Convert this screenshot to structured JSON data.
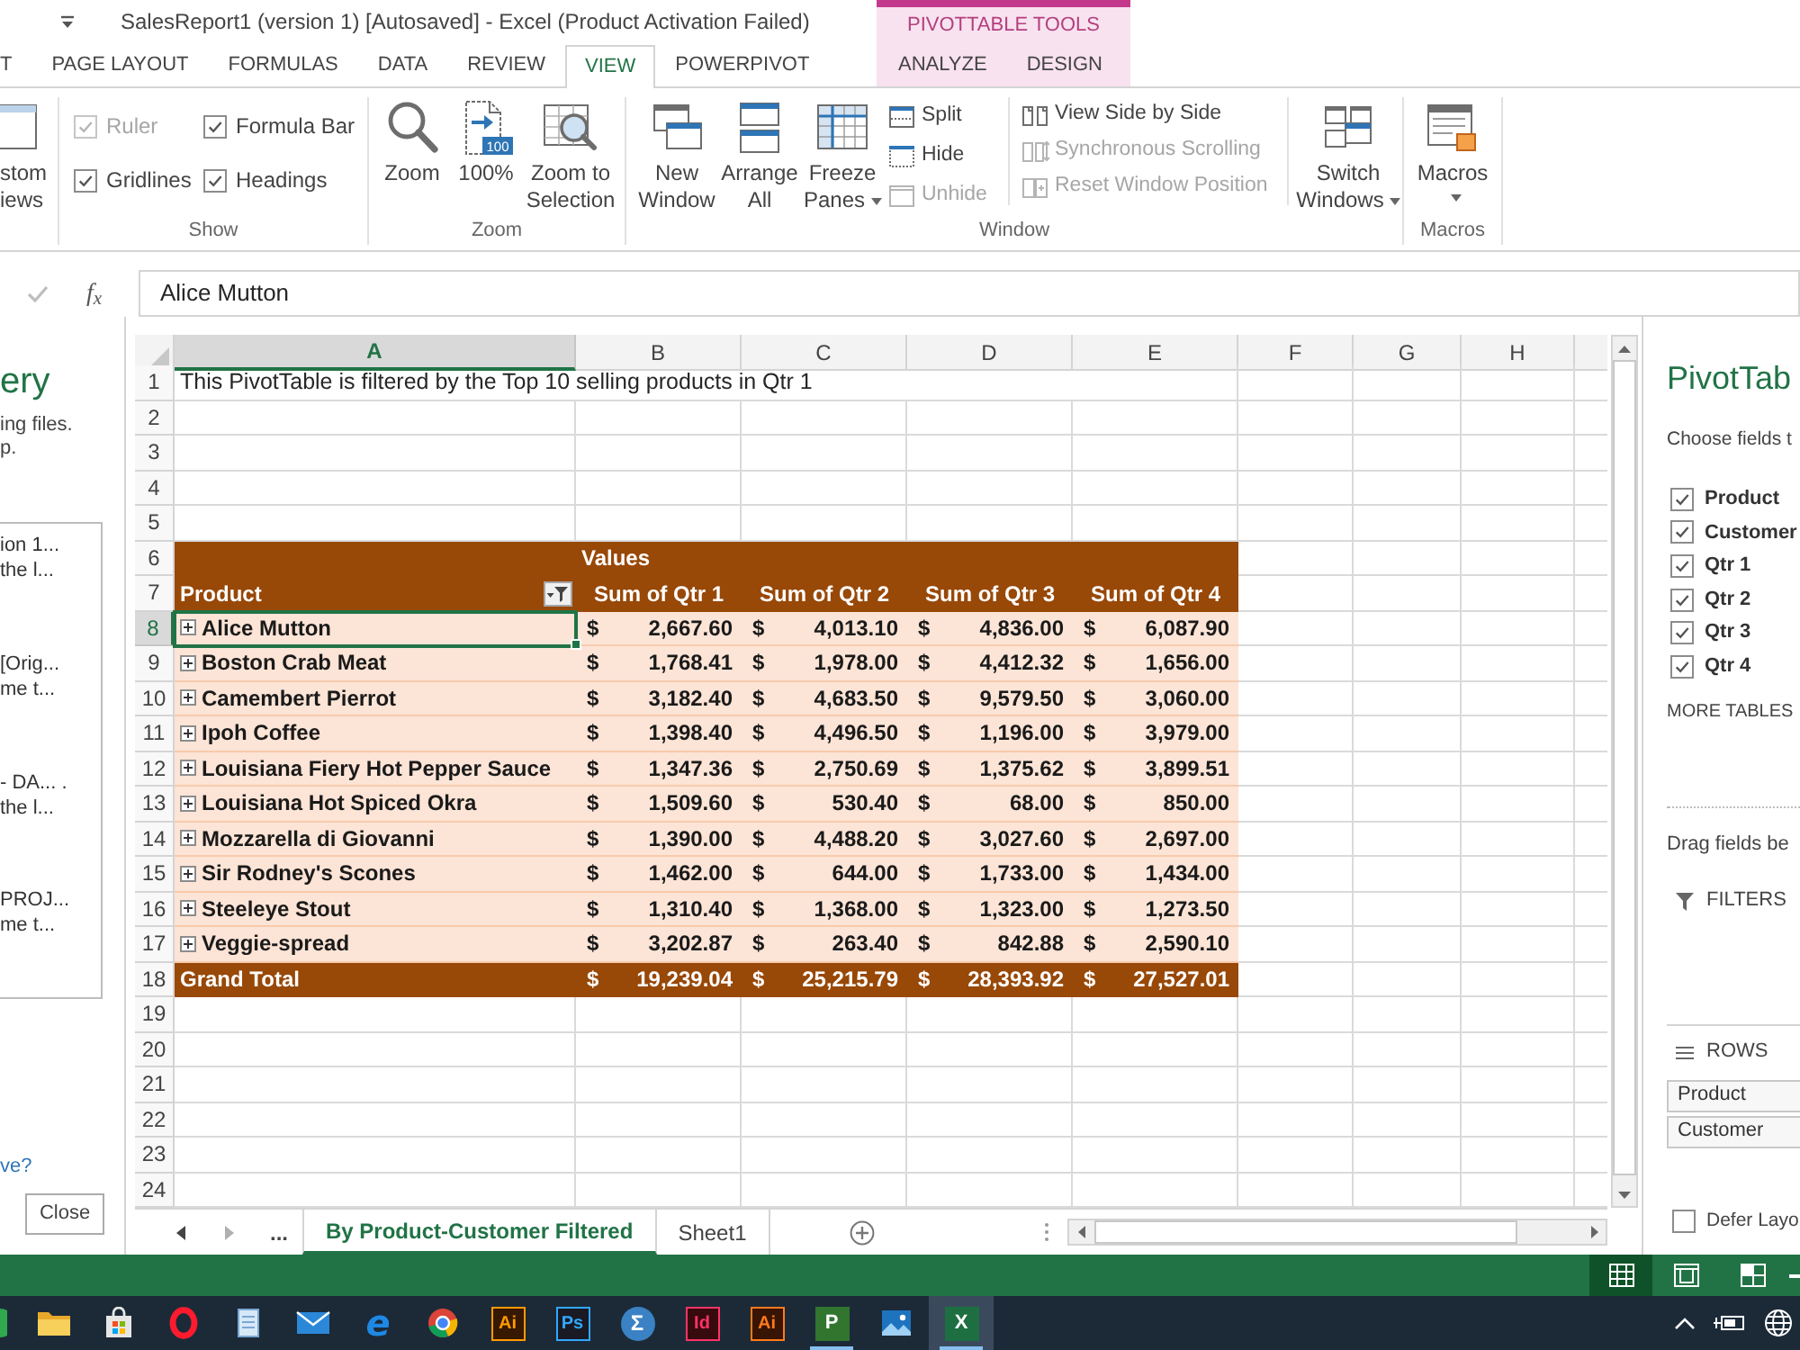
{
  "window": {
    "title": "SalesReport1 (version 1) [Autosaved] - Excel (Product Activation Failed)"
  },
  "ribbon_tabs": [
    {
      "label": "T",
      "selected": false
    },
    {
      "label": "PAGE LAYOUT",
      "selected": false
    },
    {
      "label": "FORMULAS",
      "selected": false
    },
    {
      "label": "DATA",
      "selected": false
    },
    {
      "label": "REVIEW",
      "selected": false
    },
    {
      "label": "VIEW",
      "selected": true
    },
    {
      "label": "POWERPIVOT",
      "selected": false
    }
  ],
  "contextual_tabs": {
    "label": "PIVOTTABLE TOOLS",
    "tabs": [
      {
        "label": "ANALYZE",
        "selected": false
      },
      {
        "label": "DESIGN",
        "selected": false
      }
    ]
  },
  "ribbon": {
    "custom_views": {
      "lines": [
        "stom",
        "iews"
      ]
    },
    "show_group": {
      "label": "Show",
      "options": [
        {
          "label": "Ruler",
          "checked": true,
          "disabled": true
        },
        {
          "label": "Formula Bar",
          "checked": true,
          "disabled": false
        },
        {
          "label": "Gridlines",
          "checked": true,
          "disabled": false
        },
        {
          "label": "Headings",
          "checked": true,
          "disabled": false
        }
      ]
    },
    "zoom_group": {
      "label": "Zoom",
      "buttons": [
        {
          "kind": "zoom",
          "lines": [
            "Zoom"
          ]
        },
        {
          "kind": "full_size",
          "lines": [
            "100%"
          ],
          "badge": "100"
        },
        {
          "kind": "zoom_selection",
          "lines": [
            "Zoom to",
            "Selection"
          ]
        }
      ]
    },
    "window_group": {
      "label": "Window",
      "large_buttons": [
        {
          "kind": "new_window",
          "lines": [
            "New",
            "Window"
          ],
          "dropdown": false
        },
        {
          "kind": "arrange",
          "lines": [
            "Arrange",
            "All"
          ],
          "dropdown": false
        },
        {
          "kind": "freeze",
          "lines": [
            "Freeze",
            "Panes"
          ],
          "dropdown": true
        }
      ],
      "small_columns": [
        [
          {
            "kind": "split",
            "label": "Split",
            "disabled": false
          },
          {
            "kind": "hide",
            "label": "Hide",
            "disabled": false
          },
          {
            "kind": "unhide",
            "label": "Unhide",
            "disabled": true
          }
        ],
        [
          {
            "kind": "side_by_side",
            "label": "View Side by Side",
            "disabled": false
          },
          {
            "kind": "sync_scroll",
            "label": "Synchronous Scrolling",
            "disabled": true
          },
          {
            "kind": "reset_position",
            "label": "Reset Window Position",
            "disabled": true
          }
        ]
      ],
      "switch_button": {
        "kind": "switch",
        "lines": [
          "Switch",
          "Windows"
        ],
        "dropdown": true
      }
    },
    "macros_group": {
      "label": "Macros",
      "button": {
        "kind": "macros",
        "label": "Macros",
        "dropdown": true
      }
    }
  },
  "formula_bar": {
    "function_label": "f$_{x}$",
    "value": "Alice Mutton"
  },
  "recovery_pane": {
    "title": "ery",
    "description": [
      "ing files.",
      "p."
    ],
    "files": [
      {
        "name": "ion 1...",
        "detail": "the l..."
      },
      {
        "name": "[Orig...",
        "detail": "me t..."
      },
      {
        "name": "- DA... .",
        "detail": "the l..."
      },
      {
        "name": "PROJ...",
        "detail": "me t..."
      }
    ],
    "link": "ve?",
    "close_button": "Close"
  },
  "sheet": {
    "columns": [
      {
        "label": "A",
        "selected": true
      },
      {
        "label": "B",
        "selected": false
      },
      {
        "label": "C",
        "selected": false
      },
      {
        "label": "D",
        "selected": false
      },
      {
        "label": "E",
        "selected": false
      },
      {
        "label": "F",
        "selected": false
      },
      {
        "label": "G",
        "selected": false
      },
      {
        "label": "H",
        "selected": false
      }
    ],
    "rows": [
      {
        "number": "1",
        "selected": false,
        "kind": "note",
        "text": "This PivotTable is filtered by the Top 10 selling products in Qtr 1"
      },
      {
        "number": "2",
        "selected": false,
        "kind": "empty"
      },
      {
        "number": "3",
        "selected": false,
        "kind": "empty"
      },
      {
        "number": "4",
        "selected": false,
        "kind": "empty"
      },
      {
        "number": "5",
        "selected": false,
        "kind": "empty"
      },
      {
        "number": "6",
        "selected": false,
        "kind": "pivot_caption",
        "caption": "Values"
      },
      {
        "number": "7",
        "selected": false,
        "kind": "pivot_header",
        "label": "Product",
        "filtered": true,
        "headers": [
          "Sum of Qtr 1",
          "Sum of Qtr 2",
          "Sum of Qtr 3",
          "Sum of Qtr 4"
        ]
      },
      {
        "number": "8",
        "selected": true,
        "kind": "pivot_item",
        "label": "Alice Mutton",
        "collapsed": true,
        "values": [
          {
            "symbol": "$",
            "amount": "2,667.60"
          },
          {
            "symbol": "$",
            "amount": "4,013.10"
          },
          {
            "symbol": "$",
            "amount": "4,836.00"
          },
          {
            "symbol": "$",
            "amount": "6,087.90"
          }
        ]
      },
      {
        "number": "9",
        "selected": false,
        "kind": "pivot_item",
        "label": "Boston Crab Meat",
        "collapsed": true,
        "values": [
          {
            "symbol": "$",
            "amount": "1,768.41"
          },
          {
            "symbol": "$",
            "amount": "1,978.00"
          },
          {
            "symbol": "$",
            "amount": "4,412.32"
          },
          {
            "symbol": "$",
            "amount": "1,656.00"
          }
        ]
      },
      {
        "number": "10",
        "selected": false,
        "kind": "pivot_item",
        "label": "Camembert Pierrot",
        "collapsed": true,
        "values": [
          {
            "symbol": "$",
            "amount": "3,182.40"
          },
          {
            "symbol": "$",
            "amount": "4,683.50"
          },
          {
            "symbol": "$",
            "amount": "9,579.50"
          },
          {
            "symbol": "$",
            "amount": "3,060.00"
          }
        ]
      },
      {
        "number": "11",
        "selected": false,
        "kind": "pivot_item",
        "label": "Ipoh Coffee",
        "collapsed": true,
        "values": [
          {
            "symbol": "$",
            "amount": "1,398.40"
          },
          {
            "symbol": "$",
            "amount": "4,496.50"
          },
          {
            "symbol": "$",
            "amount": "1,196.00"
          },
          {
            "symbol": "$",
            "amount": "3,979.00"
          }
        ]
      },
      {
        "number": "12",
        "selected": false,
        "kind": "pivot_item",
        "label": "Louisiana Fiery Hot Pepper Sauce",
        "collapsed": true,
        "values": [
          {
            "symbol": "$",
            "amount": "1,347.36"
          },
          {
            "symbol": "$",
            "amount": "2,750.69"
          },
          {
            "symbol": "$",
            "amount": "1,375.62"
          },
          {
            "symbol": "$",
            "amount": "3,899.51"
          }
        ]
      },
      {
        "number": "13",
        "selected": false,
        "kind": "pivot_item",
        "label": "Louisiana Hot Spiced Okra",
        "collapsed": true,
        "values": [
          {
            "symbol": "$",
            "amount": "1,509.60"
          },
          {
            "symbol": "$",
            "amount": "530.40"
          },
          {
            "symbol": "$",
            "amount": "68.00"
          },
          {
            "symbol": "$",
            "amount": "850.00"
          }
        ]
      },
      {
        "number": "14",
        "selected": false,
        "kind": "pivot_item",
        "label": "Mozzarella di Giovanni",
        "collapsed": true,
        "values": [
          {
            "symbol": "$",
            "amount": "1,390.00"
          },
          {
            "symbol": "$",
            "amount": "4,488.20"
          },
          {
            "symbol": "$",
            "amount": "3,027.60"
          },
          {
            "symbol": "$",
            "amount": "2,697.00"
          }
        ]
      },
      {
        "number": "15",
        "selected": false,
        "kind": "pivot_item",
        "label": "Sir Rodney's Scones",
        "collapsed": true,
        "values": [
          {
            "symbol": "$",
            "amount": "1,462.00"
          },
          {
            "symbol": "$",
            "amount": "644.00"
          },
          {
            "symbol": "$",
            "amount": "1,733.00"
          },
          {
            "symbol": "$",
            "amount": "1,434.00"
          }
        ]
      },
      {
        "number": "16",
        "selected": false,
        "kind": "pivot_item",
        "label": "Steeleye Stout",
        "collapsed": true,
        "values": [
          {
            "symbol": "$",
            "amount": "1,310.40"
          },
          {
            "symbol": "$",
            "amount": "1,368.00"
          },
          {
            "symbol": "$",
            "amount": "1,323.00"
          },
          {
            "symbol": "$",
            "amount": "1,273.50"
          }
        ]
      },
      {
        "number": "17",
        "selected": false,
        "kind": "pivot_item",
        "label": "Veggie-spread",
        "collapsed": true,
        "values": [
          {
            "symbol": "$",
            "amount": "3,202.87"
          },
          {
            "symbol": "$",
            "amount": "263.40"
          },
          {
            "symbol": "$",
            "amount": "842.88"
          },
          {
            "symbol": "$",
            "amount": "2,590.10"
          }
        ]
      },
      {
        "number": "18",
        "selected": false,
        "kind": "pivot_total",
        "label": "Grand Total",
        "values": [
          {
            "symbol": "$",
            "amount": "19,239.04"
          },
          {
            "symbol": "$",
            "amount": "25,215.79"
          },
          {
            "symbol": "$",
            "amount": "28,393.92"
          },
          {
            "symbol": "$",
            "amount": "27,527.01"
          }
        ]
      },
      {
        "number": "19",
        "selected": false,
        "kind": "empty"
      },
      {
        "number": "20",
        "selected": false,
        "kind": "empty"
      },
      {
        "number": "21",
        "selected": false,
        "kind": "empty"
      },
      {
        "number": "22",
        "selected": false,
        "kind": "empty"
      },
      {
        "number": "23",
        "selected": false,
        "kind": "empty"
      },
      {
        "number": "24",
        "selected": false,
        "kind": "empty"
      }
    ]
  },
  "sheet_tabs": {
    "overflow": "...",
    "tabs": [
      {
        "label": "By Product-Customer Filtered",
        "selected": true
      },
      {
        "label": "Sheet1",
        "selected": false
      }
    ]
  },
  "field_list": {
    "title": "PivotTab",
    "prompt": "Choose fields t",
    "fields": [
      {
        "label": "Product",
        "checked": true
      },
      {
        "label": "Customer",
        "checked": true
      },
      {
        "label": "Qtr 1",
        "checked": true
      },
      {
        "label": "Qtr 2",
        "checked": true
      },
      {
        "label": "Qtr 3",
        "checked": true
      },
      {
        "label": "Qtr 4",
        "checked": true
      }
    ],
    "more_tables": "MORE TABLES",
    "drag_hint": "Drag fields be",
    "areas": [
      {
        "kind": "filters",
        "label": "FILTERS"
      },
      {
        "kind": "rows",
        "label": "ROWS",
        "items": [
          "Product",
          "Customer"
        ]
      }
    ],
    "defer_update": {
      "label": "Defer Layo",
      "checked": false
    }
  },
  "status_bar": {
    "views": [
      {
        "kind": "normal",
        "selected": true
      },
      {
        "kind": "page_layout",
        "selected": false
      },
      {
        "kind": "page_break",
        "selected": false
      }
    ]
  },
  "taskbar": {
    "apps": [
      {
        "kind": "partial",
        "selected": false
      },
      {
        "kind": "folder",
        "running": false,
        "selected": false
      },
      {
        "kind": "store",
        "running": false,
        "selected": false
      },
      {
        "kind": "ring",
        "running": false,
        "selected": false
      },
      {
        "kind": "notepad",
        "running": false,
        "selected": false
      },
      {
        "kind": "mail",
        "running": false,
        "selected": false
      },
      {
        "kind": "orbit",
        "letters": "e",
        "color": "#1e88e5",
        "running": false,
        "selected": false
      },
      {
        "kind": "wheel",
        "running": false,
        "selected": false
      },
      {
        "kind": "tile",
        "letters": "Ai",
        "color": "#ff9a00",
        "running": false,
        "selected": false
      },
      {
        "kind": "tile",
        "letters": "Ps",
        "color": "#31a8ff",
        "running": false,
        "selected": false
      },
      {
        "kind": "round",
        "letters": "Σ",
        "color": "#3b82c4",
        "running": false,
        "selected": false
      },
      {
        "kind": "tile",
        "letters": "Id",
        "color": "#ff3366",
        "running": false,
        "selected": false
      },
      {
        "kind": "tile",
        "letters": "Ai",
        "color": "#ff7a1a",
        "running": false,
        "selected": false
      },
      {
        "kind": "solid",
        "letters": "P",
        "color": "#31752f",
        "running": true,
        "selected": false
      },
      {
        "kind": "photos",
        "running": false,
        "selected": false
      },
      {
        "kind": "solid",
        "letters": "X",
        "color": "#1d6f42",
        "running": true,
        "selected": true
      }
    ]
  }
}
